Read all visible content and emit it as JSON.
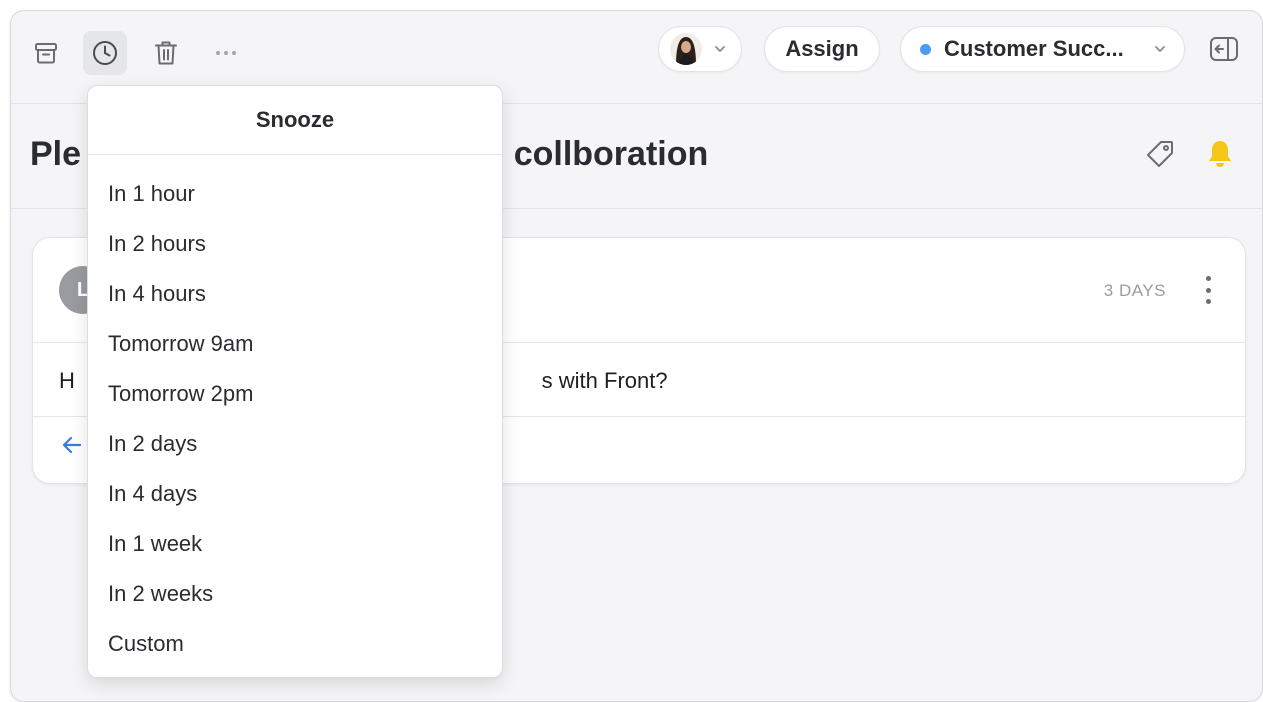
{
  "toolbar": {
    "archive_icon": "archive-icon",
    "snooze_icon": "clock-icon",
    "delete_icon": "trash-icon",
    "more_icon": "more-horizontal-icon",
    "assignee_icon": "avatar",
    "assign_label": "Assign",
    "team_label": "Customer Succ...",
    "team_dot_color": "#4d9cf2",
    "exit_icon": "exit-icon"
  },
  "conversation": {
    "title_start": "Ple",
    "title_end": "collboration",
    "tag_icon": "tag-icon",
    "bell_icon": "bell-icon",
    "bell_color": "#f5c518"
  },
  "message": {
    "avatar_initial": "L",
    "time": "3 DAYS",
    "text_start": "H",
    "text_end": "s with Front?"
  },
  "snooze_menu": {
    "title": "Snooze",
    "options": [
      "In 1 hour",
      "In 2 hours",
      "In 4 hours",
      "Tomorrow 9am",
      "Tomorrow 2pm",
      "In 2 days",
      "In 4 days",
      "In 1 week",
      "In 2 weeks",
      "Custom"
    ]
  },
  "colors": {
    "accent_blue": "#4d9cf2",
    "bell_yellow": "#f5c518"
  }
}
